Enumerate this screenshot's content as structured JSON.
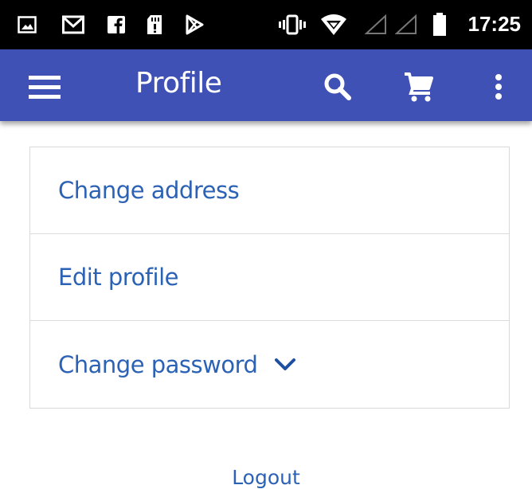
{
  "status_bar": {
    "time": "17:25",
    "left_icons": [
      "gallery-icon",
      "gmail-icon",
      "facebook-icon",
      "sd-card-icon",
      "play-store-icon"
    ],
    "right_icons": [
      "vibrate-icon",
      "wifi-icon",
      "signal-icon",
      "signal-icon",
      "battery-icon"
    ]
  },
  "app_bar": {
    "title": "Profile",
    "color": "#3f51b5",
    "icons": [
      "menu-icon",
      "search-icon",
      "cart-icon",
      "more-vert-icon"
    ]
  },
  "menu": {
    "items": [
      {
        "label": "Change address"
      },
      {
        "label": "Edit profile"
      },
      {
        "label": "Change password",
        "icon": "chevron-down-icon"
      }
    ]
  },
  "logout_label": "Logout",
  "link_color": "#2c62b5"
}
